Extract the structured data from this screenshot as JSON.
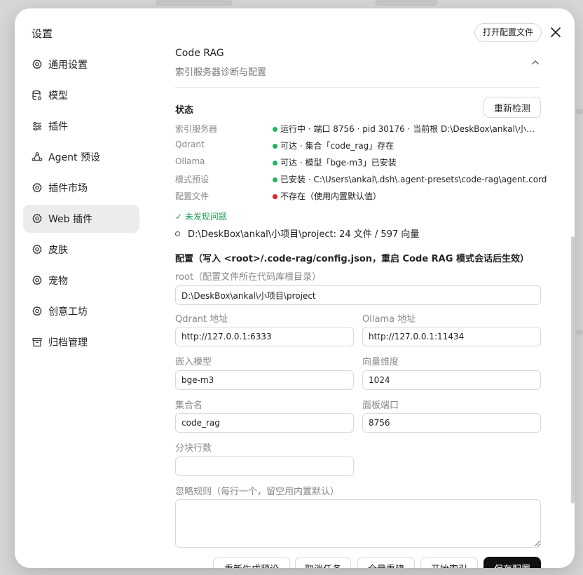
{
  "modal": {
    "title": "设置",
    "open_config_button": "打开配置文件"
  },
  "sidebar": {
    "items": [
      {
        "label": "通用设置",
        "icon": "gear-icon"
      },
      {
        "label": "模型",
        "icon": "database-icon"
      },
      {
        "label": "插件",
        "icon": "sliders-icon"
      },
      {
        "label": "Agent 预设",
        "icon": "agent-icon"
      },
      {
        "label": "插件市场",
        "icon": "gear-icon"
      },
      {
        "label": "Web 插件",
        "icon": "gear-icon",
        "active": true
      },
      {
        "label": "皮肤",
        "icon": "gear-icon"
      },
      {
        "label": "宠物",
        "icon": "gear-icon"
      },
      {
        "label": "创意工坊",
        "icon": "gear-icon"
      },
      {
        "label": "归档管理",
        "icon": "archive-icon"
      }
    ]
  },
  "section": {
    "title": "Code RAG",
    "subtitle": "索引服务器诊断与配置"
  },
  "status": {
    "heading": "状态",
    "recheck_button": "重新检测",
    "rows": [
      {
        "key": "索引服务器",
        "value": "运行中 · 端口 8756 · pid 30176 · 当前根 D:\\DeskBox\\ankal\\小项目\\project",
        "color": "#22b35e"
      },
      {
        "key": "Qdrant",
        "value": "可达 · 集合「code_rag」存在",
        "color": "#22b35e"
      },
      {
        "key": "Ollama",
        "value": "可达 · 模型「bge-m3」已安装",
        "color": "#22b35e"
      },
      {
        "key": "模式预设",
        "value": "已安装 · C:\\Users\\ankal\\.dsh\\.agent-presets\\code-rag\\agent.cordis.yml",
        "color": "#22b35e"
      },
      {
        "key": "配置文件",
        "value": "不存在（使用内置默认值）",
        "color": "#e02424"
      }
    ],
    "ok_message": "✓ 未发现问题",
    "index_summary": "D:\\DeskBox\\ankal\\小项目\\project:  24 文件 / 597 向量"
  },
  "config": {
    "heading": "配置（写入 <root>/.code-rag/config.json，重启 Code RAG 模式会话后生效）",
    "root_label": "root（配置文件所在代码库根目录）",
    "root_value": "D:\\DeskBox\\ankal\\小项目\\project",
    "qdrant_label": "Qdrant 地址",
    "qdrant_value": "http://127.0.0.1:6333",
    "ollama_label": "Ollama 地址",
    "ollama_value": "http://127.0.0.1:11434",
    "embed_label": "嵌入模型",
    "embed_value": "bge-m3",
    "dim_label": "向量维度",
    "dim_value": "1024",
    "collection_label": "集合名",
    "collection_value": "code_rag",
    "port_label": "面板端口",
    "port_value": "8756",
    "chunk_label": "分块行数",
    "chunk_value": "",
    "ignore_label": "忽略规则（每行一个，留空用内置默认）"
  },
  "actions": {
    "regen": "重新生成预设",
    "cancel": "取消任务",
    "rebuild": "全量重建",
    "start": "开始索引",
    "save": "保存配置"
  }
}
